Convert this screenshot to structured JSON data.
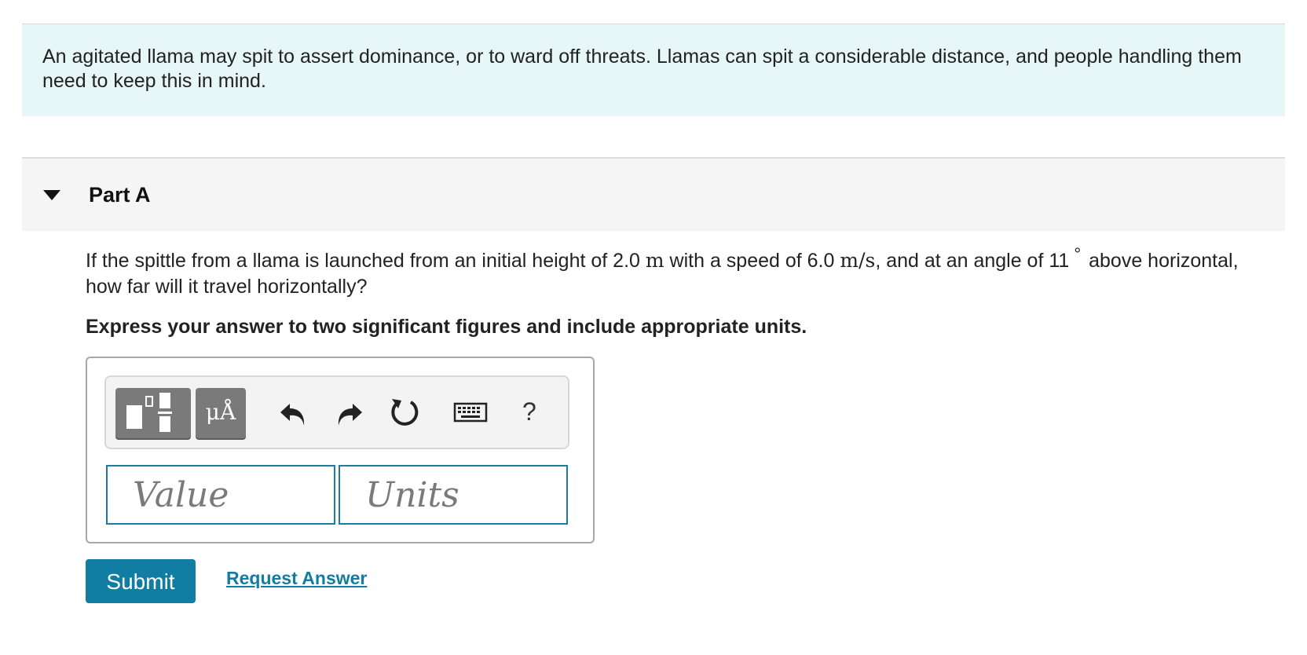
{
  "intro": {
    "text": "An agitated llama may spit to assert dominance, or to ward off threats. Llamas can spit a considerable distance, and people handling them need to keep this in mind."
  },
  "part": {
    "title": "Part A",
    "expanded_icon": "caret-down-icon"
  },
  "question": {
    "text_1": "If the spittle from a llama is launched from an initial height of 2.0",
    "unit_height": "m",
    "text_2": "with a speed of 6.0",
    "unit_speed": "m/s",
    "text_3": ", and at an angle of 11",
    "degree": "°",
    "text_4": "above horizontal, how far will it travel horizontally?"
  },
  "instruction": "Express your answer to two significant figures and include appropriate units.",
  "toolbar": {
    "templates_icon": "templates-icon",
    "symbols_label": "μÅ",
    "undo_icon": "undo-icon",
    "redo_icon": "redo-icon",
    "reset_icon": "reset-icon",
    "keyboard_icon": "keyboard-icon",
    "help_label": "?"
  },
  "fields": {
    "value_placeholder": "Value",
    "units_placeholder": "Units"
  },
  "actions": {
    "submit_label": "Submit",
    "request_label": "Request Answer"
  },
  "colors": {
    "intro_bg": "#e7f6f6",
    "accent": "#127da3",
    "toolbar_button": "#7a7a7a"
  }
}
